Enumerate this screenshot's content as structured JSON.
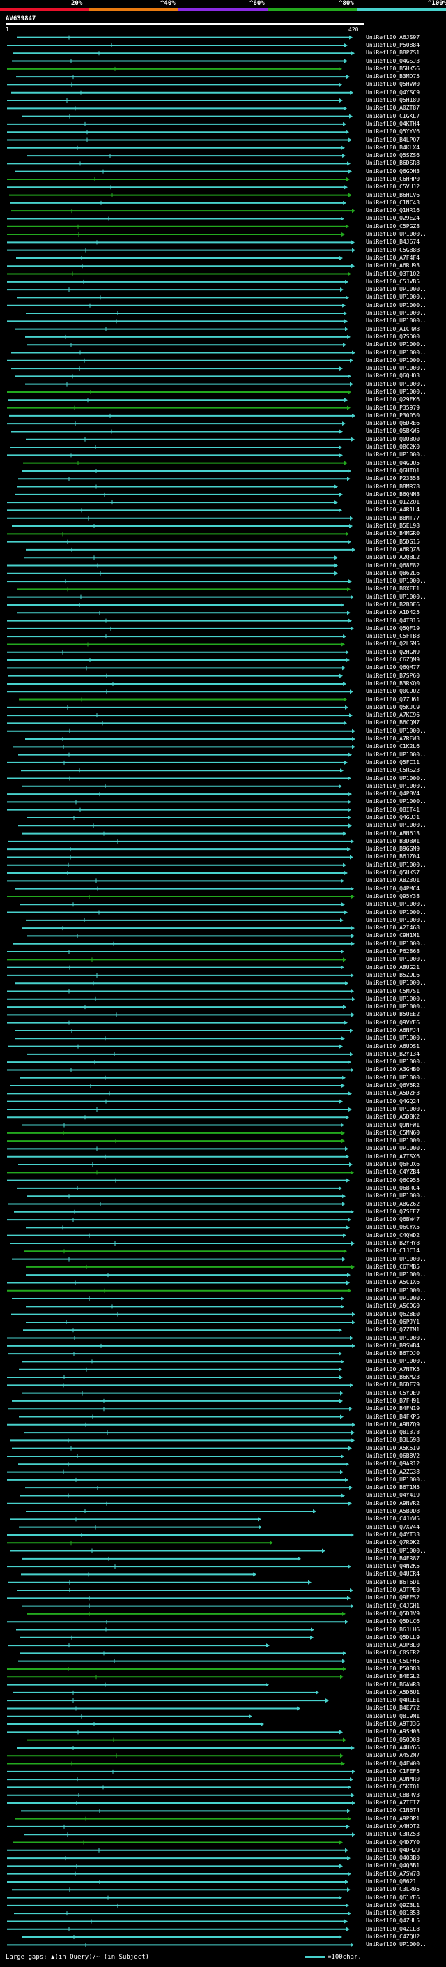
{
  "legend": {
    "labels": [
      "20%",
      "^40%",
      "^60%",
      "^80%",
      "^100%"
    ],
    "colors": [
      "#e8102a",
      "#e87a10",
      "#8a2be2",
      "#23a81e",
      "#48d1cc"
    ]
  },
  "query": {
    "name": "AV639847",
    "start": "1",
    "end": "420"
  },
  "footer": {
    "gaps_text": "Large gaps: ▲(in Query)/~ (in Subject)",
    "scale_text": "=100char."
  },
  "hits": {
    "labels": [
      "UniRef100_A6JS97",
      "UniRef100_P50884",
      "UniRef100_B8P7S1",
      "UniRef100_Q4GSJ3",
      "UniRef100_B5HK56",
      "UniRef100_B3MD75",
      "UniRef100_Q5HVW0",
      "UniRef100_Q4YSC9",
      "UniRef100_Q5H189",
      "UniRef100_A0ZT87",
      "UniRef100_C1GKL7",
      "UniRef100_Q4KTH4",
      "UniRef100_Q5YYV6",
      "UniRef100_B4LPQ7",
      "UniRef100_B4KLX4",
      "UniRef100_Q5SZS6",
      "UniRef100_B6DSR8",
      "UniRef100_Q6GDH3",
      "UniRef100_C6HHP0",
      "UniRef100_C5VUJ2",
      "UniRef100_B6HLV6",
      "UniRef100_C1NC43",
      "UniRef100_Q1HR16",
      "UniRef100_Q29EZ4",
      "UniRef100_C5PGZ8",
      "UniRef100_UP1000..",
      "UniRef100_B4J674",
      "UniRef100_C5GB8B",
      "UniRef100_A7F4F4",
      "UniRef100_A6RU93",
      "UniRef100_Q3T1Q2",
      "UniRef100_C5JVB5",
      "UniRef100_UP1000..",
      "UniRef100_UP1000..",
      "UniRef100_UP1000..",
      "UniRef100_UP1000..",
      "UniRef100_UP1000..",
      "UniRef100_A1CRW8",
      "UniRef100_Q7SD00",
      "UniRef100_UP1000..",
      "UniRef100_UP1000..",
      "UniRef100_UP1000..",
      "UniRef100_UP1000..",
      "UniRef100_Q6QHO3",
      "UniRef100_UP1000..",
      "UniRef100_UP1000..",
      "UniRef100_Q29FK6",
      "UniRef100_P35979",
      "UniRef100_P30050",
      "UniRef100_Q6DRE6",
      "UniRef100_Q5BKW5",
      "UniRef100_Q0UBQ0",
      "UniRef100_Q8C2K0",
      "UniRef100_UP1000..",
      "UniRef100_Q4GQU5",
      "UniRef100_Q6HTQ1",
      "UniRef100_P23358",
      "UniRef100_B8MR78",
      "UniRef100_B6QNN8",
      "UniRef100_Q1ZZQ1",
      "UniRef100_A4R1L4",
      "UniRef100_B8MT77",
      "UniRef100_B5EL98",
      "UniRef100_B4MGR0",
      "UniRef100_B5DG15",
      "UniRef100_A6RQZ8",
      "UniRef100_A2QBL2",
      "UniRef100_Q68F82",
      "UniRef100_Q862L6",
      "UniRef100_UP1000..",
      "UniRef100_B0XEE1",
      "UniRef100_UP1000..",
      "UniRef100_B2B0F6",
      "UniRef100_A1D425",
      "UniRef100_Q4T815",
      "UniRef100_Q5QF19",
      "UniRef100_C5FTB8",
      "UniRef100_Q2LGM5",
      "UniRef100_Q2HGN9",
      "UniRef100_C6ZQM9",
      "UniRef100_Q6QM77",
      "UniRef100_B7SP60",
      "UniRef100_B3RKQ0",
      "UniRef100_Q0CUU2",
      "UniRef100_Q7ZU61",
      "UniRef100_Q5KJC9",
      "UniRef100_A7KC96",
      "UniRef100_B6CQM7",
      "UniRef100_UP1000..",
      "UniRef100_A7REW3",
      "UniRef100_C1K2L6",
      "UniRef100_UP1000..",
      "UniRef100_Q5FC11",
      "UniRef100_C5RS23",
      "UniRef100_UP1000..",
      "UniRef100_UP1000..",
      "UniRef100_Q4PBV4",
      "UniRef100_UP1000..",
      "UniRef100_Q8IT41",
      "UniRef100_Q4GUJ1",
      "UniRef100_UP1000..",
      "UniRef100_A8N6J3",
      "UniRef100_B3DBW1",
      "UniRef100_B9GGM9",
      "UniRef100_B6JZ04",
      "UniRef100_UP1000..",
      "UniRef100_Q5UKS7",
      "UniRef100_A8Z3Q1",
      "UniRef100_Q4PMC4",
      "UniRef100_Q95Y38",
      "UniRef100_UP1000..",
      "UniRef100_UP1000..",
      "UniRef100_UP1000..",
      "UniRef100_A2I468",
      "UniRef100_C9H1M1",
      "UniRef100_UP1000..",
      "UniRef100_P62868",
      "UniRef100_UP1000..",
      "UniRef100_A8UG21",
      "UniRef100_B5Z9L6",
      "UniRef100_UP1000..",
      "UniRef100_C5M7S1",
      "UniRef100_UP1000..",
      "UniRef100_UP1000..",
      "UniRef100_B5UEE2",
      "UniRef100_Q9VYE6",
      "UniRef100_A6NFJ4",
      "UniRef100_UP1000..",
      "UniRef100_A6UDS1",
      "UniRef100_B2Y134",
      "UniRef100_UP1000..",
      "UniRef100_A3GHB0",
      "UniRef100_UP1000..",
      "UniRef100_Q6V5R2",
      "UniRef100_A5DZF3",
      "UniRef100_Q4GQ24",
      "UniRef100_UP1000..",
      "UniRef100_A5DBK2",
      "UniRef100_Q9NFW1",
      "UniRef100_C5MN60",
      "UniRef100_UP1000..",
      "UniRef100_UP1000..",
      "UniRef100_A7TSX6",
      "UniRef100_Q6FUX6",
      "UniRef100_C4YZB4",
      "UniRef100_Q6C955",
      "UniRef100_Q6BRC4",
      "UniRef100_UP1000..",
      "UniRef100_A8GZ62",
      "UniRef100_Q7SEE7",
      "UniRef100_Q6BW47",
      "UniRef100_Q6CYX5",
      "UniRef100_C4QWD2",
      "UniRef100_B2YHY8",
      "UniRef100_C1JC14",
      "UniRef100_UP1000..",
      "UniRef100_C6TMB5",
      "UniRef100_UP1000..",
      "UniRef100_A5C1X6",
      "UniRef100_UP1000..",
      "UniRef100_UP1000..",
      "UniRef100_A5C9G0",
      "UniRef100_Q6Z8E0",
      "UniRef100_Q6PJY1",
      "UniRef100_Q7ZTM1",
      "UniRef100_UP1000..",
      "UniRef100_B9SWB4",
      "UniRef100_B6TDJ0",
      "UniRef100_UP1000..",
      "UniRef100_A7NTK5",
      "UniRef100_B6KM23",
      "UniRef100_B6DF79",
      "UniRef100_C5YOE9",
      "UniRef100_B7FH91",
      "UniRef100_B4FN19",
      "UniRef100_B4FKP5",
      "UniRef100_A9NZQ9",
      "UniRef100_Q8I378",
      "UniRef100_B3L698",
      "UniRef100_A5K5I9",
      "UniRef100_Q6B8V2",
      "UniRef100_Q9AR12",
      "UniRef100_A2ZG38",
      "UniRef100_UP1000..",
      "UniRef100_B6T1M5",
      "UniRef100_Q4Y419",
      "UniRef100_A9NVR2",
      "UniRef100_A5B0D8",
      "UniRef100_C4JYW5",
      "UniRef100_Q7XV44",
      "UniRef100_Q4YT33",
      "UniRef100_Q7R0K2",
      "UniRef100_UP1000..",
      "UniRef100_B4FR87",
      "UniRef100_Q4N2K5",
      "UniRef100_Q4UCR4",
      "UniRef100_B6T6D1",
      "UniRef100_A9TPE0",
      "UniRef100_Q9FFS2",
      "UniRef100_C4JGH1",
      "UniRef100_Q5DJV9",
      "UniRef100_Q5DLC6",
      "UniRef100_B6JLH6",
      "UniRef100_Q5DLL9",
      "UniRef100_A9PBL0",
      "UniRef100_C0SER2",
      "UniRef100_C5LFH5",
      "UniRef100_P50883",
      "UniRef100_B4EGL2",
      "UniRef100_B6AWR8",
      "UniRef100_A5D6U1",
      "UniRef100_Q4RLE1",
      "UniRef100_B4E772",
      "UniRef100_Q819M1",
      "UniRef100_A9TJ36",
      "UniRef100_A9SH03",
      "UniRef100_Q5QD03",
      "UniRef100_A4HY66",
      "UniRef100_A4S2M7",
      "UniRef100_Q4FW00",
      "UniRef100_C1FEF5",
      "UniRef100_A9NMR0",
      "UniRef100_C5KTQ1",
      "UniRef100_C8BRV3",
      "UniRef100_A7TEI7",
      "UniRef100_C1N6T4",
      "UniRef100_A9PBP1",
      "UniRef100_A4HDT2",
      "UniRef100_C3RZ53",
      "UniRef100_Q4D7Y0",
      "UniRef100_Q4DH29",
      "UniRef100_Q4Q3B0",
      "UniRef100_Q4Q3B1",
      "UniRef100_A7SW78",
      "UniRef100_Q8621L",
      "UniRef100_C3LR05",
      "UniRef100_Q61YE6",
      "UniRef100_Q9Z3L1",
      "UniRef100_Q01B53",
      "UniRef100_Q4ZHL5",
      "UniRef100_Q4ZCL8",
      "UniRef100_C4ZQU2",
      "UniRef100_UP1000.."
    ]
  }
}
